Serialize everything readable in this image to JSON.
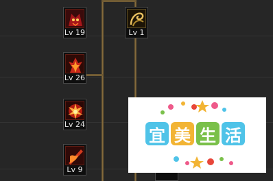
{
  "skills": [
    {
      "level": "Lv 19",
      "icon": "demon-mask-icon"
    },
    {
      "level": "Lv 1",
      "icon": "golden-swirl-icon"
    },
    {
      "level": "Lv 26",
      "icon": "fire-tree-icon"
    },
    {
      "level": "Lv 24",
      "icon": "fire-burst-icon"
    },
    {
      "level": "Lv 9",
      "icon": "flame-blade-icon"
    }
  ],
  "watermark": {
    "text": [
      "宜",
      "美",
      "生",
      "活"
    ],
    "tile_colors": [
      "#4fc3e8",
      "#f2b434",
      "#7ac04a",
      "#4fc3e8"
    ]
  },
  "colors": {
    "background": "#262626",
    "connector": "#8c7140"
  }
}
